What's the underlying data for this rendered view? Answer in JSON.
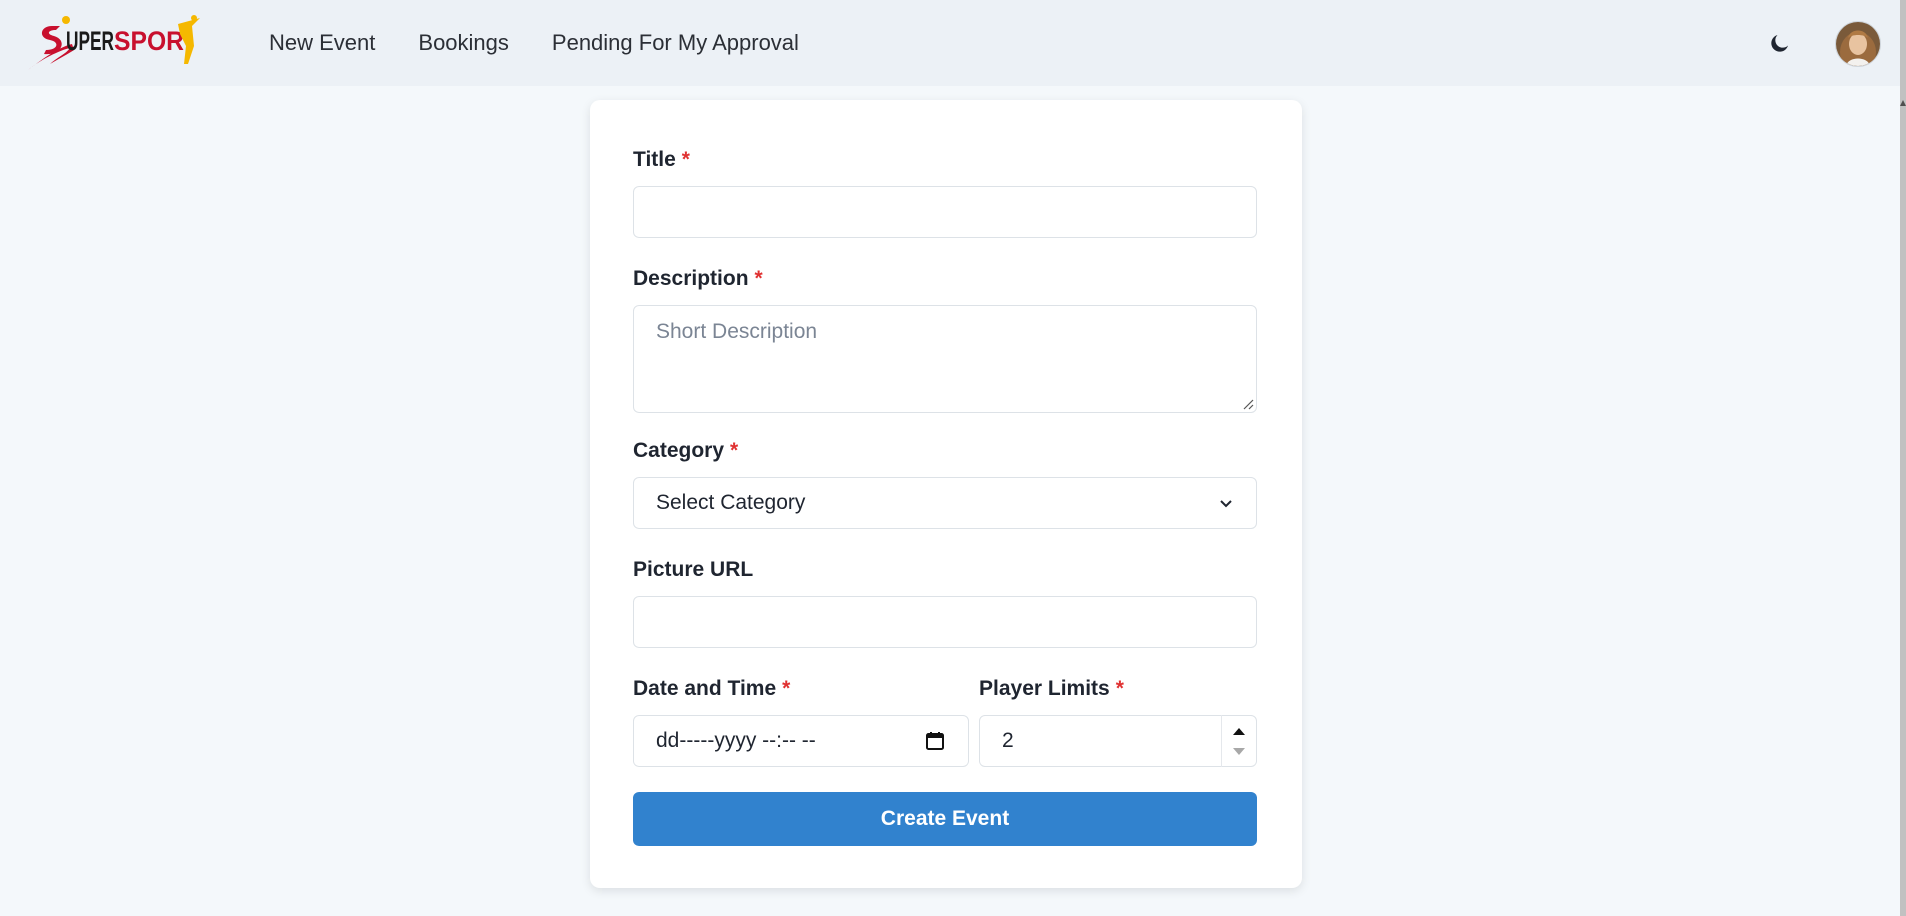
{
  "nav": {
    "brand_name": "SUPERSPORT",
    "links": [
      "New Event",
      "Bookings",
      "Pending For My Approval"
    ]
  },
  "form": {
    "required_mark": "*",
    "title": {
      "label": "Title",
      "value": ""
    },
    "description": {
      "label": "Description",
      "placeholder": "Short Description"
    },
    "category": {
      "label": "Category",
      "selected": "Select Category"
    },
    "picture_url": {
      "label": "Picture URL",
      "value": ""
    },
    "date_time": {
      "label": "Date and Time",
      "placeholder": "dd-----yyyy --:-- --"
    },
    "player_limits": {
      "label": "Player Limits",
      "value": "2"
    },
    "submit_label": "Create Event"
  },
  "colors": {
    "primary": "#3182ce",
    "required": "#e03131",
    "navbar_bg": "#ecf1f6",
    "page_bg": "#f4f8fb",
    "logo_red": "#c8102e",
    "logo_yellow": "#f5b800"
  }
}
